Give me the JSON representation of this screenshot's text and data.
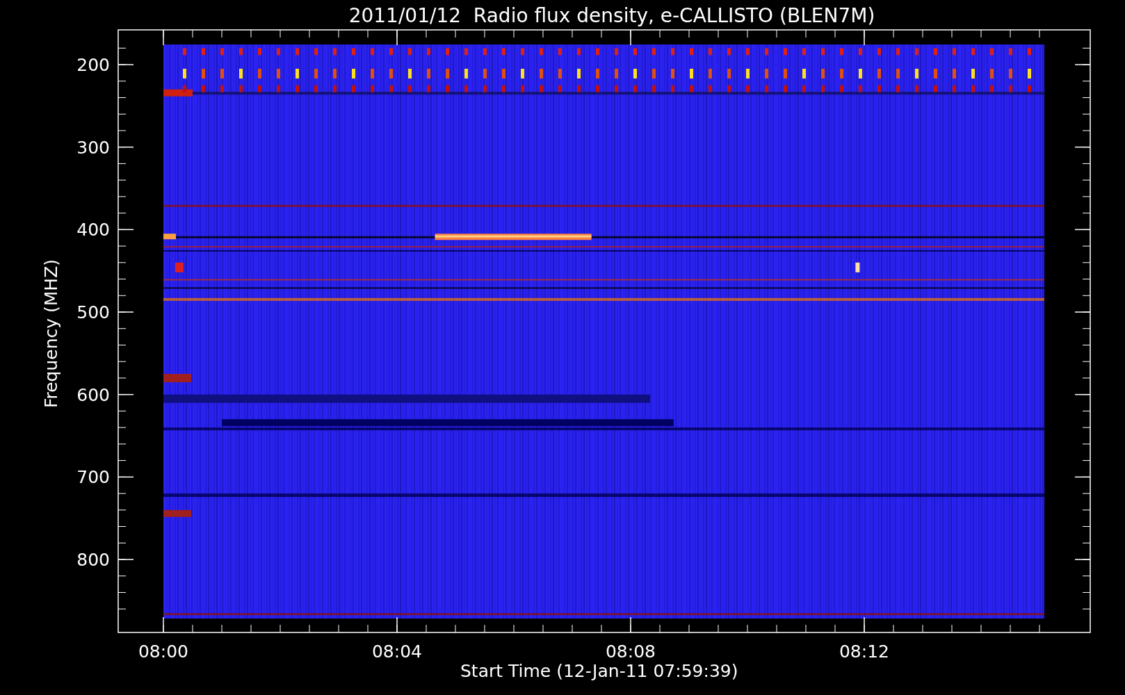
{
  "title": "2011/01/12  Radio flux density, e-CALLISTO (BLEN7M)",
  "y_axis": {
    "label": "Frequency (MHZ)",
    "ticks": [
      "200",
      "300",
      "400",
      "500",
      "600",
      "700",
      "800"
    ]
  },
  "x_axis": {
    "label": "Start Time (12-Jan-11 07:59:39)",
    "ticks": [
      "08:00",
      "08:04",
      "08:08",
      "08:12"
    ]
  }
}
